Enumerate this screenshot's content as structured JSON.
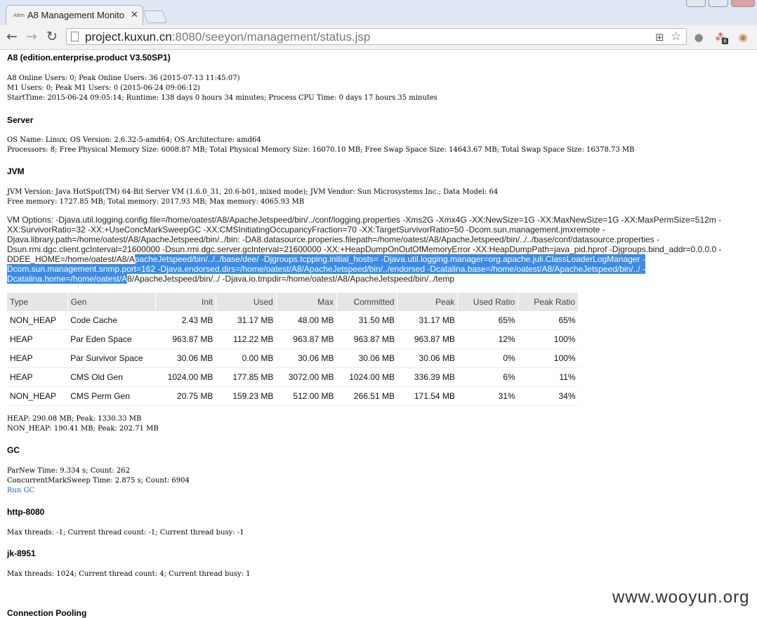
{
  "browser": {
    "tab_title": "A8 Management Monito",
    "tab_favicon": "A8m",
    "close_glyph": "✕",
    "url_host": "project.kuxun.cn",
    "url_rest": ":8080/seeyon/management/status.jsp",
    "ext_badge": "6"
  },
  "page": {
    "product": "A8 (edition.enterprise.product V3.50SP1)",
    "summary": [
      "A8 Online Users: 0; Peak Online Users: 36 (2015-07-13 11:45:07)",
      "M1 Users: 0; Peak M1 Users: 0 (2015-06-24 09:06:12)",
      "StartTime: 2015-06-24 09:05:14; Runtime: 138 days 0 hours 34 minutes; Process CPU Time: 0 days 17 hours 35 minutes"
    ],
    "server": {
      "heading": "Server",
      "lines": [
        "OS Name: Linux; OS Version: 2.6.32-5-amd64; OS Architecture: amd64",
        "Processors: 8; Free Physical Memory Size: 6008.87 MB; Total Physical Memory Size: 16070.10 MB; Free Swap Space Size: 14643.67 MB; Total Swap Space Size: 16378.73 MB"
      ]
    },
    "jvm": {
      "heading": "JVM",
      "lines": [
        "JVM Version: Java HotSpot(TM) 64-Bit Server VM (1.6.0_31, 20.6-b01, mixed mode); JVM Vendor: Sun Microsystems Inc.; Data Model: 64",
        "Free memory: 1727.85 MB; Total memory: 2017.93 MB; Max memory: 4065.93 MB"
      ],
      "vm_options_before": "VM Options: -Djava.util.logging.config.file=/home/oatest/A8/ApacheJetspeed/bin/../conf/logging.properties -Xms2G -Xmx4G -XX:NewSize=1G -XX:MaxNewSize=1G -XX:MaxPermSize=512m -XX:SurvivorRatio=32 -XX:+UseConcMarkSweepGC -XX:CMSInitiatingOccupancyFraction=70 -XX:TargetSurvivorRatio=50 -Dcom.sun.management.jmxremote -Djava.library.path=/home/oatest/A8/ApacheJetspeed/bin/../bin: -DA8.datasource.properies.filepath=/home/oatest/A8/ApacheJetspeed/bin/../../base/conf/datasource.properties -Dsun.rmi.dgc.client.gcInterval=21600000 -Dsun.rmi.dgc.server.gcInterval=21600000 -XX:+HeapDumpOnOutOfMemoryError -XX:HeapDumpPath=java_pid.hprof -Djgroups.bind_addr=0.0.0.0 -DDEE_HOME=/home/oatest/A8/A",
      "vm_options_selected": "pacheJetspeed/bin/../../base/dee/ -Djgroups.tcpping.initial_hosts= -Djava.util.logging.manager=org.apache.juli.ClassLoaderLogManager -Dcom.sun.management.snmp.port=162 -Djava.endorsed.dirs=/home/oatest/A8/ApacheJetspeed/bin/../endorsed -Dcatalina.base=/home/oatest/A8/ApacheJetspeed/bin/../ -Dcatalina.home=/home/oatest/A",
      "vm_options_after": "8/ApacheJetspeed/bin/../ -Djava.io.tmpdir=/home/oatest/A8/ApacheJetspeed/bin/../temp"
    },
    "memory_table": {
      "headers": [
        "Type",
        "Gen",
        "Init",
        "Used",
        "Max",
        "Committed",
        "Peak",
        "Used Ratio",
        "Peak Ratio"
      ],
      "rows": [
        [
          "NON_HEAP",
          "Code Cache",
          "2.43 MB",
          "31.17 MB",
          "48.00 MB",
          "31.50 MB",
          "31.17 MB",
          "65%",
          "65%"
        ],
        [
          "HEAP",
          "Par Eden Space",
          "963.87 MB",
          "112.22 MB",
          "963.87 MB",
          "963.87 MB",
          "963.87 MB",
          "12%",
          "100%"
        ],
        [
          "HEAP",
          "Par Survivor Space",
          "30.06 MB",
          "0.00 MB",
          "30.06 MB",
          "30.06 MB",
          "30.06 MB",
          "0%",
          "100%"
        ],
        [
          "HEAP",
          "CMS Old Gen",
          "1024.00 MB",
          "177.85 MB",
          "3072.00 MB",
          "1024.00 MB",
          "336.39 MB",
          "6%",
          "11%"
        ],
        [
          "NON_HEAP",
          "CMS Perm Gen",
          "20.75 MB",
          "159.23 MB",
          "512.00 MB",
          "266.51 MB",
          "171.54 MB",
          "31%",
          "34%"
        ]
      ]
    },
    "memory_summary": [
      "HEAP: 290.08 MB; Peak: 1330.33 MB",
      "NON_HEAP: 190.41 MB; Peak: 202.71 MB"
    ],
    "gc": {
      "heading": "GC",
      "lines": [
        "ParNew  Time: 9.334 s; Count: 262",
        "ConcurrentMarkSweep  Time: 2.875 s; Count: 6904"
      ],
      "run_link": "Run GC"
    },
    "http": {
      "heading": "http-8080",
      "line": "Max threads: -1; Current thread count: -1; Current thread busy: -1"
    },
    "jk": {
      "heading": "jk-8951",
      "line": "Max threads: 1024; Current thread count: 4; Current thread busy: 1"
    },
    "pool_heading": "Connection Pooling"
  },
  "watermark": "www.wooyun.org"
}
